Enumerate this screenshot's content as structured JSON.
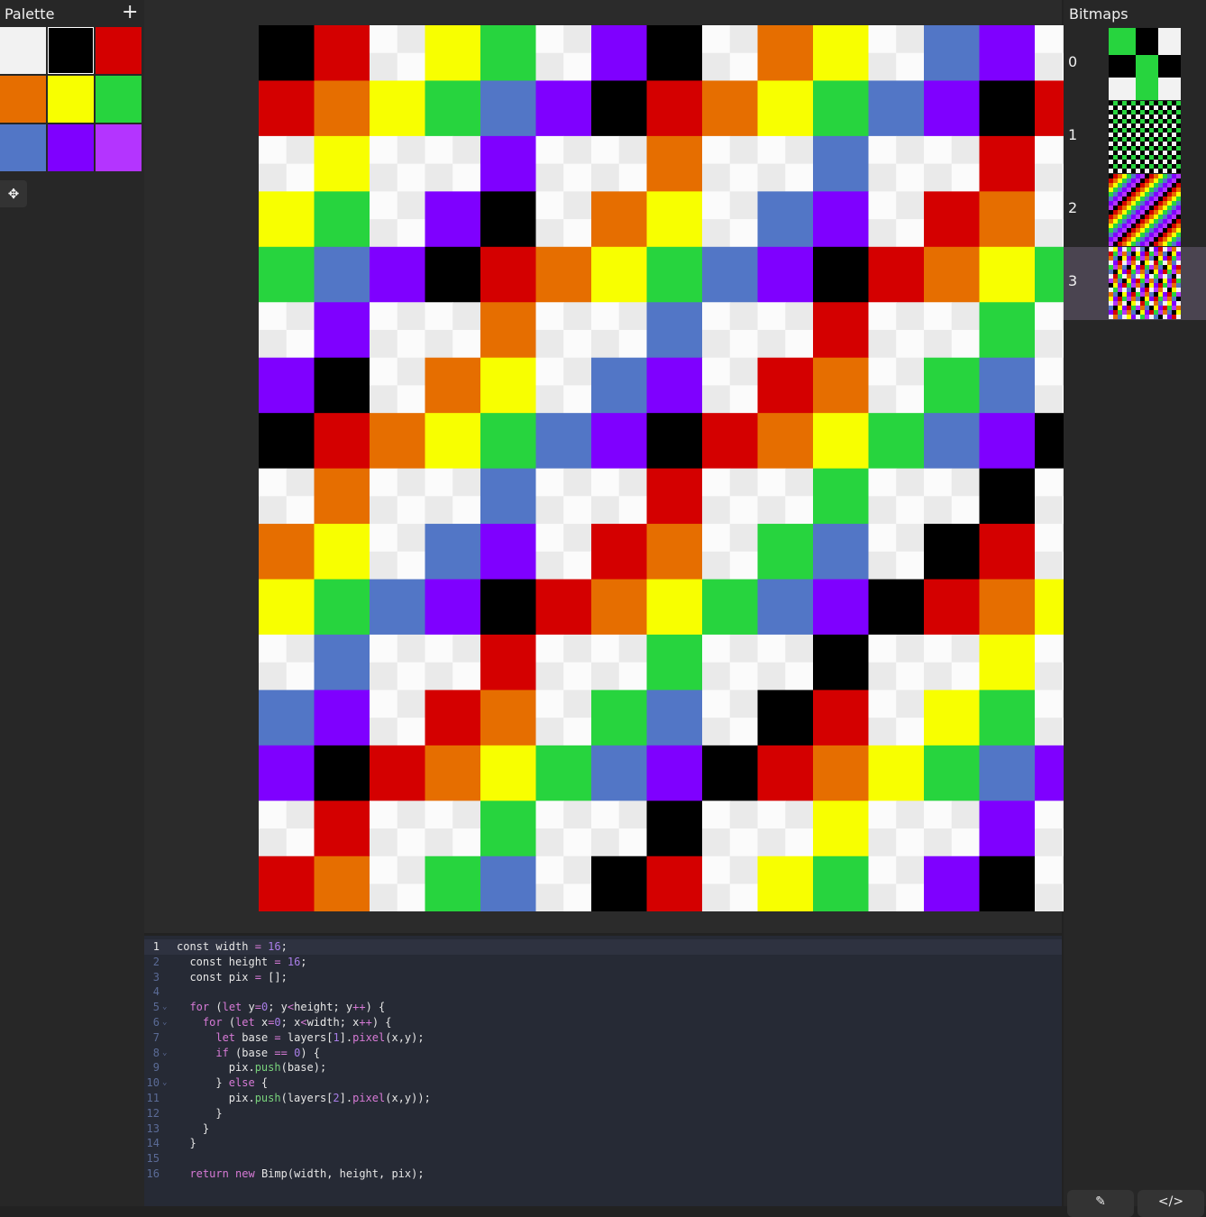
{
  "palette": {
    "title": "Palette",
    "add_icon": "plus-icon",
    "add_label": "+",
    "selected_index": 1,
    "colors": [
      "#f2f2f2",
      "#000000",
      "#d40000",
      "#e66e00",
      "#f8ff00",
      "#27d43e",
      "#5276c6",
      "#7f00ff",
      "#b434ff"
    ]
  },
  "tools": {
    "move_icon": "move-icon",
    "move_label": "✥"
  },
  "canvas": {
    "transparent_colors": [
      "#fbfbfb",
      "#eaeaea"
    ],
    "colors": [
      "#f2f2f2",
      "#000000",
      "#d40000",
      "#e66e00",
      "#f8ff00",
      "#27d43e",
      "#5276c6",
      "#7f00ff"
    ],
    "cells": [
      "1 2 0 4 5 0 7 1 0 3 4 0 6 7 0",
      "2 3 4 5 6 7 1 2 3 4 5 6 7 1 2",
      "0 4 0 0 7 0 0 3 0 0 6 0 0 2 0",
      "4 5 0 7 1 0 3 4 0 6 7 0 2 3 0",
      "5 6 7 1 2 3 4 5 6 7 1 2 3 4 5",
      "0 7 0 0 3 0 0 6 0 0 2 0 0 5 0",
      "7 1 0 3 4 0 6 7 0 2 3 0 5 6 0",
      "1 2 3 4 5 6 7 1 2 3 4 5 6 7 1",
      "0 3 0 0 6 0 0 2 0 0 5 0 0 1 0",
      "3 4 0 6 7 0 2 3 0 5 6 0 1 2 0",
      "4 5 6 7 1 2 3 4 5 6 7 1 2 3 4",
      "0 6 0 0 2 0 0 5 0 0 1 0 0 4 0",
      "6 7 0 2 3 0 5 6 0 1 2 0 4 5 0",
      "7 1 2 3 4 5 6 7 1 2 3 4 5 6 7",
      "0 2 0 0 5 0 0 1 0 0 4 0 0 7 0",
      "2 3 0 5 6 0 1 2 0 4 5 0 7 1 0"
    ]
  },
  "editor": {
    "active_line": 1,
    "lines": [
      {
        "n": "1",
        "fold": "",
        "html": "<span>const</span> width <span class='op'>=</span> <span class='num'>16</span>;"
      },
      {
        "n": "2",
        "fold": "",
        "html": "  <span>const</span> height <span class='op'>=</span> <span class='num'>16</span>;"
      },
      {
        "n": "3",
        "fold": "",
        "html": "  <span>const</span> pix <span class='op'>=</span> [];"
      },
      {
        "n": "4",
        "fold": "",
        "html": ""
      },
      {
        "n": "5",
        "fold": "⌄",
        "html": "  <span class='kw'>for</span> (<span class='kw'>let</span> y<span class='op'>=</span><span class='num'>0</span>; y<span class='op'>&lt;</span>height; y<span class='op'>++</span>) {"
      },
      {
        "n": "6",
        "fold": "⌄",
        "html": "    <span class='kw'>for</span> (<span class='kw'>let</span> x<span class='op'>=</span><span class='num'>0</span>; x<span class='op'>&lt;</span>width; x<span class='op'>++</span>) {"
      },
      {
        "n": "7",
        "fold": "",
        "html": "      <span class='kw'>let</span> base <span class='op'>=</span> layers[<span class='num'>1</span>].<span class='kw'>pixel</span>(x,y);"
      },
      {
        "n": "8",
        "fold": "⌄",
        "html": "      <span class='kw'>if</span> (base <span class='op'>==</span> <span class='num'>0</span>) {"
      },
      {
        "n": "9",
        "fold": "",
        "html": "        pix.<span class='fn'>push</span>(base);"
      },
      {
        "n": "10",
        "fold": "⌄",
        "html": "      } <span class='kw'>else</span> {"
      },
      {
        "n": "11",
        "fold": "",
        "html": "        pix.<span class='fn'>push</span>(layers[<span class='num'>2</span>].<span class='kw'>pixel</span>(x,y));"
      },
      {
        "n": "12",
        "fold": "",
        "html": "      }"
      },
      {
        "n": "13",
        "fold": "",
        "html": "    }"
      },
      {
        "n": "14",
        "fold": "",
        "html": "  }"
      },
      {
        "n": "15",
        "fold": "",
        "html": ""
      },
      {
        "n": "16",
        "fold": "",
        "html": "  <span class='kw'>return</span> <span class='kw'>new</span> Bimp(width, height, pix);"
      }
    ]
  },
  "bitmaps": {
    "title": "Bitmaps",
    "selected_index": 3,
    "items": [
      {
        "label": "0",
        "pattern": "checker3"
      },
      {
        "label": "1",
        "pattern": "dots"
      },
      {
        "label": "2",
        "pattern": "stripes"
      },
      {
        "label": "3",
        "pattern": "combined"
      }
    ]
  },
  "modes": [
    {
      "name": "draw-mode-button",
      "icon": "brush-icon",
      "label": "✎"
    },
    {
      "name": "code-mode-button",
      "icon": "code-icon",
      "label": "</>"
    }
  ]
}
